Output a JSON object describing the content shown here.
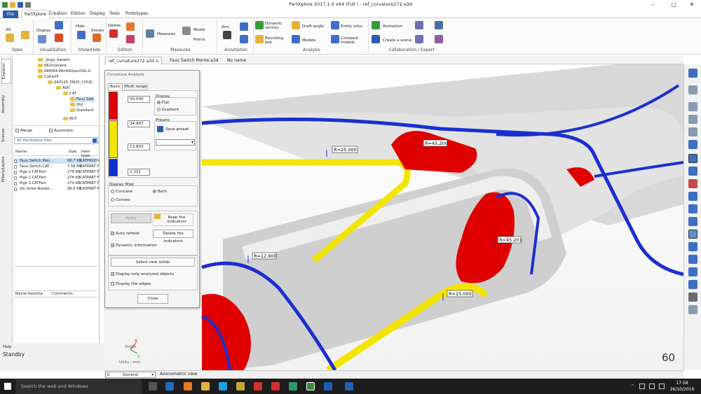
{
  "window": {
    "title": "PartXplore 2017.1.0 x64 (Full ) - ref_curvature272.a3d",
    "min": "–",
    "max": "▢",
    "close": "✕"
  },
  "menu_tabs": [
    "File",
    "PartXplore",
    "Creation",
    "Edition",
    "Display",
    "Tools",
    "Prototypes"
  ],
  "ribbon": {
    "groups": [
      {
        "label": "Open",
        "buttons": [
          "3D"
        ]
      },
      {
        "label": "Visualization",
        "buttons": [
          "Display"
        ]
      },
      {
        "label": "Show/Hide",
        "buttons": [
          "Hide",
          "Shown"
        ]
      },
      {
        "label": "Edition",
        "buttons": [
          "Delete"
        ]
      },
      {
        "label": "Measures",
        "buttons": [
          "Measures",
          "Model",
          "Points"
        ]
      },
      {
        "label": "Annotation",
        "buttons": [
          "Ann."
        ]
      },
      {
        "label": "Analysis",
        "buttons": [
          "Dynamic section",
          "Bounding box",
          "Draft angle",
          "Models",
          "Entity infos",
          "Compare models"
        ]
      },
      {
        "label": "Collaboration / Export",
        "buttons": [
          "Animation",
          "Create a scene"
        ]
      }
    ]
  },
  "left_vtabs": [
    "Explorer",
    "Assembly",
    "Scenes",
    "Filters/Layers"
  ],
  "tree": [
    "_bugs_datakit",
    "662masselo",
    "AMD64-Win64OpenSSL-0",
    "CatiaV5",
    "040125_FAUX_COUS",
    "A00",
    "CAT",
    "Faux Swit",
    "Old",
    "Standard",
    "RCP"
  ],
  "explorer": {
    "merge_label": "Merge",
    "automatic_label": "Automatic",
    "filter_value": "All PartXplore files",
    "col_name": "Name",
    "col_size": "Size",
    "col_type": "Item type",
    "files": [
      {
        "name": "Faux Switch Mon...",
        "size": "68,7 KB",
        "type": "CATPRODU"
      },
      {
        "name": "Faux Switch.CAT...",
        "size": "7,58 MB",
        "type": "CATPART F"
      },
      {
        "name": "Pige 1.CATPart",
        "size": "278 KB",
        "type": "CATPART F"
      },
      {
        "name": "Pige 2.CATPart",
        "size": "276 KB",
        "type": "CATPART F"
      },
      {
        "name": "Pige 3.CATPart",
        "size": "274 KB",
        "type": "CATPART F"
      },
      {
        "name": "Vis striee Norele...",
        "size": "98,9 KB",
        "type": "CATPART F"
      }
    ],
    "fav_col_name": "Name favorite",
    "fav_col_comments": "Comments"
  },
  "status": {
    "help": "Help",
    "state": "Standby"
  },
  "doc_tabs": [
    {
      "label": "ref_curvature272.a3d",
      "active": true
    },
    {
      "label": "Faux Switch Monte.a3d",
      "active": false
    },
    {
      "label": "No name",
      "active": false
    }
  ],
  "dialog": {
    "title": "Curvature Analysis",
    "tab_basic": "Basic",
    "tab_multi": "Multi range",
    "values": [
      "50.000",
      "34.967",
      "13.803",
      "2.331"
    ],
    "colors": [
      "#e00000",
      "#f2e600",
      "#f2e600",
      "#1030d0"
    ],
    "display_label": "Display",
    "flat": "Flat",
    "gradient": "Gradient",
    "presets_label": "Presets",
    "save_preset": "Save preset",
    "display_filter_label": "Display filter",
    "concave": "Concave",
    "convex": "Convex",
    "both": "Both",
    "apply": "Apply",
    "keep_indicators": "Keep the indicators",
    "auto_refresh": "Auto refresh",
    "delete_indicators": "Delete the indicators",
    "dynamic_info": "Dynamic information",
    "select_new": "Select new solids",
    "display_only": "Display only analyzed objects",
    "display_edges": "Display the edges",
    "close": "Close"
  },
  "indicators": [
    "R=25.000",
    "R=45.200",
    "R=12.900",
    "R=45.201",
    "R=25.000"
  ],
  "viewport": {
    "fps": "60",
    "axis_x": "X",
    "axis_y": "Y",
    "origin": "Origin",
    "units": "Units : mm"
  },
  "bottom": {
    "combo_index": "0",
    "combo_value": "General",
    "view_name": "Axonometric view"
  },
  "taskbar": {
    "search": "Search the web and Windows",
    "time": "17:58",
    "date": "26/10/2016"
  }
}
